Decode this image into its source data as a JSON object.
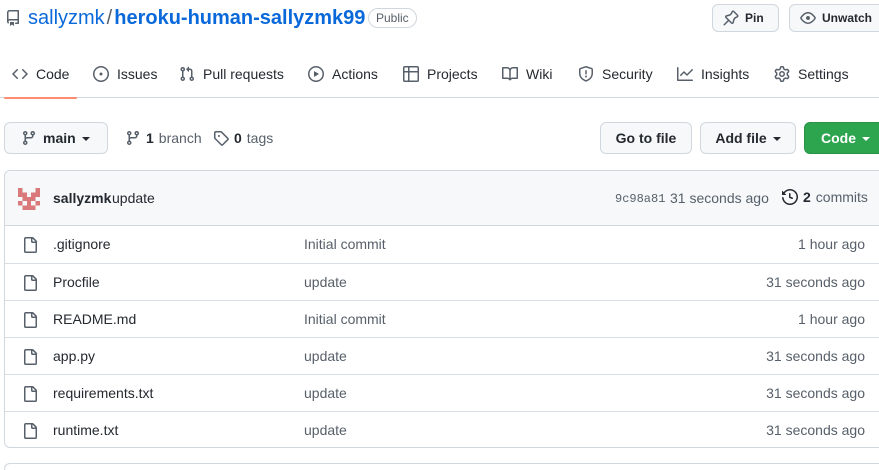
{
  "repo": {
    "owner": "sallyzmk",
    "separator": "/",
    "name": "heroku-human-sallyzmk99",
    "visibility": "Public"
  },
  "header_buttons": {
    "pin_label": "Pin",
    "watch_label": "Unwatch"
  },
  "tabs": [
    {
      "label": "Code",
      "icon": "code-icon",
      "active": true
    },
    {
      "label": "Issues",
      "icon": "issue-icon"
    },
    {
      "label": "Pull requests",
      "icon": "pull-request-icon"
    },
    {
      "label": "Actions",
      "icon": "play-icon"
    },
    {
      "label": "Projects",
      "icon": "table-icon"
    },
    {
      "label": "Wiki",
      "icon": "book-icon"
    },
    {
      "label": "Security",
      "icon": "shield-icon"
    },
    {
      "label": "Insights",
      "icon": "graph-icon"
    },
    {
      "label": "Settings",
      "icon": "gear-icon"
    }
  ],
  "toolbar": {
    "branch": "main",
    "branch_count": "1",
    "branch_label": "branch",
    "tag_count": "0",
    "tag_label": "tags",
    "goto_file_label": "Go to file",
    "add_file_label": "Add file",
    "code_label": "Code"
  },
  "latest_commit": {
    "author": "sallyzmk",
    "message": "update",
    "sha": "9c98a81",
    "time": "31 seconds ago",
    "commit_count": "2",
    "commit_label": "commits"
  },
  "files": [
    {
      "name": ".gitignore",
      "message": "Initial commit",
      "time": "1 hour ago"
    },
    {
      "name": "Procfile",
      "message": "update",
      "time": "31 seconds ago"
    },
    {
      "name": "README.md",
      "message": "Initial commit",
      "time": "1 hour ago"
    },
    {
      "name": "app.py",
      "message": "update",
      "time": "31 seconds ago"
    },
    {
      "name": "requirements.txt",
      "message": "update",
      "time": "31 seconds ago"
    },
    {
      "name": "runtime.txt",
      "message": "update",
      "time": "31 seconds ago"
    }
  ],
  "colors": {
    "link": "#0969da",
    "primary_button": "#2da44e",
    "active_tab_underline": "#fd8c73",
    "muted_text": "#57606a",
    "avatar": "#d9797b"
  }
}
